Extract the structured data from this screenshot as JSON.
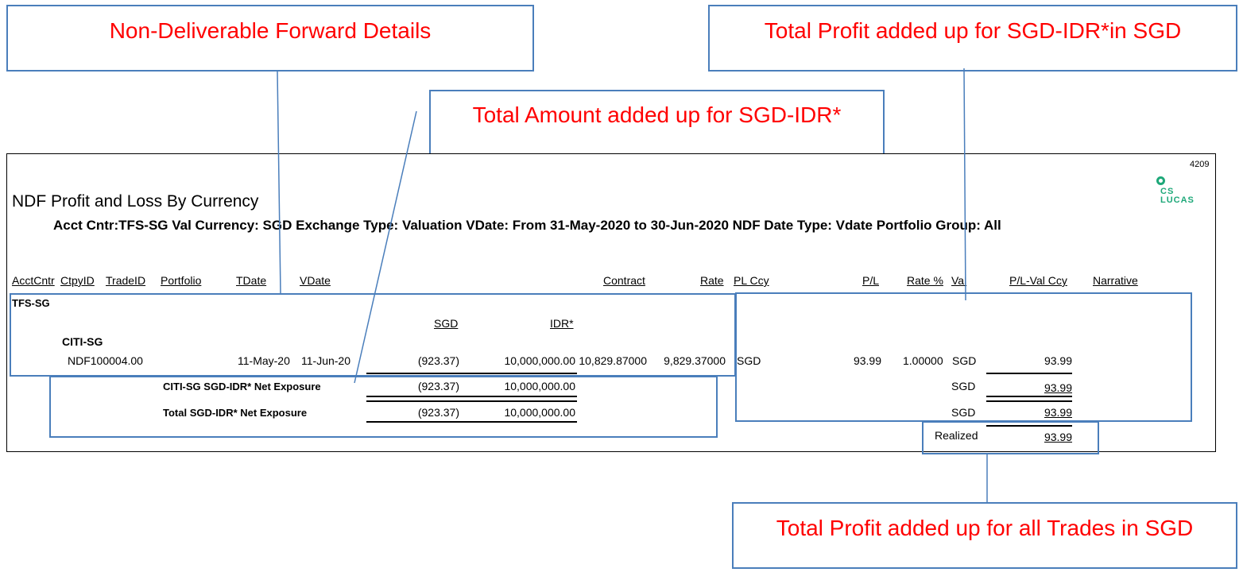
{
  "callouts": {
    "ndf_details": "Non-Deliverable Forward Details",
    "total_profit_pair": "Total Profit added up for SGD-IDR*in SGD",
    "total_amount_pair": "Total Amount added up for SGD-IDR*",
    "total_profit_all": "Total Profit added up for all Trades in SGD"
  },
  "report": {
    "page_number": "4209",
    "logo": "CS LUCAS",
    "title": "NDF Profit and Loss By Currency",
    "criteria": "Acct Cntr:TFS-SG Val Currency: SGD Exchange Type: Valuation VDate: From  31-May-2020 to  30-Jun-2020  NDF Date Type: Vdate Portfolio Group: All",
    "columns": {
      "acct_cntr": "AcctCntr",
      "ctpy_id": "CtpyID",
      "trade_id": "TradeID",
      "portfolio": "Portfolio",
      "tdate": "TDate",
      "vdate": "VDate",
      "contract": "Contract",
      "rate": "Rate",
      "pl_ccy": "PL Ccy",
      "pl": "P/L",
      "rate_pct": "Rate %",
      "val": "Val",
      "pl_val_ccy": "P/L-Val Ccy",
      "narrative": "Narrative"
    },
    "group": "TFS-SG",
    "currency_headers": {
      "ccy1": "SGD",
      "ccy2": "IDR*"
    },
    "counterparty": "CITI-SG",
    "trade": {
      "trade_id": "NDF100004.00",
      "tdate": "11-May-20",
      "vdate": "11-Jun-20",
      "sgd_amount": "(923.37)",
      "idr_amount": "10,000,000.00",
      "contract": "10,829.87000",
      "rate": "9,829.37000",
      "pl_ccy": "SGD",
      "pl": "93.99",
      "rate_pct": "1.00000",
      "val": "SGD",
      "pl_val_ccy": "93.99"
    },
    "net_exposure": {
      "label": "CITI-SG SGD-IDR* Net Exposure",
      "sgd": "(923.37)",
      "idr": "10,000,000.00",
      "val": "SGD",
      "pl_val": "93.99"
    },
    "total_exposure": {
      "label": "Total SGD-IDR* Net Exposure",
      "sgd": "(923.37)",
      "idr": "10,000,000.00",
      "val": "SGD",
      "pl_val": "93.99"
    },
    "realized": {
      "label": "Realized",
      "value": "93.99"
    }
  },
  "colors": {
    "callout_text": "#ff0000",
    "callout_border": "#4a7ebb",
    "logo": "#1ea879"
  }
}
